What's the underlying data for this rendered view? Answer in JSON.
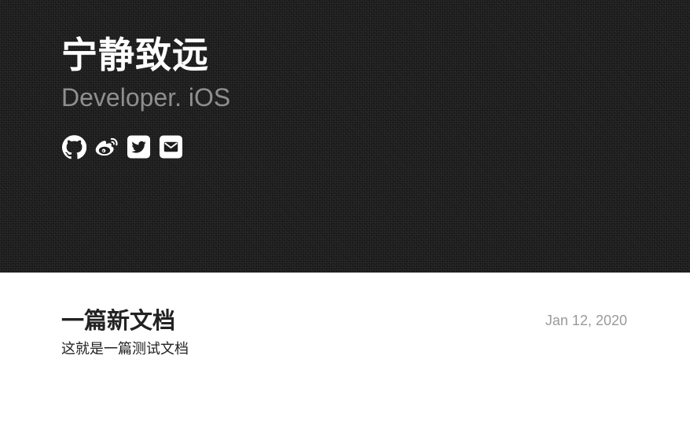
{
  "header": {
    "title": "宁静致远",
    "subtitle": "Developer. iOS",
    "social_links": [
      {
        "icon": "github-icon",
        "label": "GitHub"
      },
      {
        "icon": "weibo-icon",
        "label": "Weibo"
      },
      {
        "icon": "twitter-icon",
        "label": "Twitter"
      },
      {
        "icon": "email-icon",
        "label": "Email"
      }
    ],
    "background_color": "#1d1d1d"
  },
  "posts": [
    {
      "title": "一篇新文档",
      "date": "Jan 12, 2020",
      "excerpt": "这就是一篇测试文档"
    }
  ],
  "colors": {
    "title": "#ffffff",
    "subtitle": "#8f8f8f",
    "post_title": "#222222",
    "post_date": "#9a9a9a"
  }
}
